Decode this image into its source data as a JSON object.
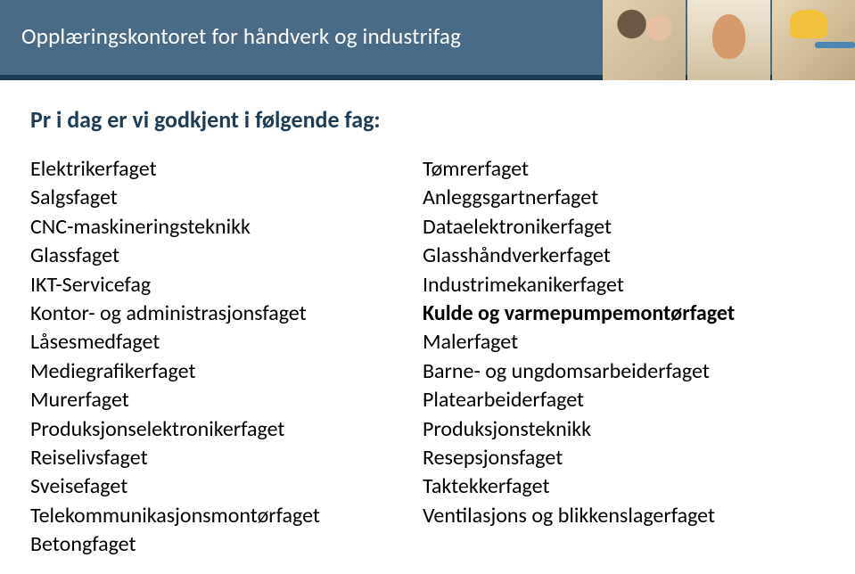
{
  "header": {
    "title": "Opplæringskontoret for håndverk og industrifag"
  },
  "intro": "Pr i dag er vi godkjent i følgende fag:",
  "left": [
    "Elektrikerfaget",
    "Salgsfaget",
    "CNC-maskineringsteknikk",
    "Glassfaget",
    "IKT-Servicefag",
    "Kontor- og administrasjonsfaget",
    "Låsesmedfaget",
    "Mediegrafikerfaget",
    "Murerfaget",
    "Produksjonselektronikerfaget",
    "Reiselivsfaget",
    "Sveisefaget",
    "Telekommunikasjonsmontørfaget",
    "Betongfaget"
  ],
  "right": [
    {
      "text": "Tømrerfaget",
      "bold": false
    },
    {
      "text": "Anleggsgartnerfaget",
      "bold": false
    },
    {
      "text": "Dataelektronikerfaget",
      "bold": false
    },
    {
      "text": "Glasshåndverkerfaget",
      "bold": false
    },
    {
      "text": "Industrimekanikerfaget",
      "bold": false
    },
    {
      "text": "Kulde og varmepumpemontørfaget",
      "bold": true
    },
    {
      "text": "Malerfaget",
      "bold": false
    },
    {
      "text": "Barne- og ungdomsarbeiderfaget",
      "bold": false
    },
    {
      "text": "Platearbeiderfaget",
      "bold": false
    },
    {
      "text": "Produksjonsteknikk",
      "bold": false
    },
    {
      "text": "Resepsjonsfaget",
      "bold": false
    },
    {
      "text": "Taktekkerfaget",
      "bold": false
    },
    {
      "text": "Ventilasjons og blikkenslagerfaget",
      "bold": false
    }
  ]
}
